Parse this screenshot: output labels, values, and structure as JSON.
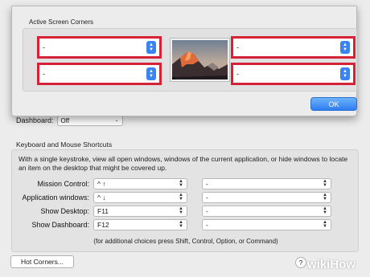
{
  "dashboard": {
    "label": "Dashboard:",
    "value": "Off"
  },
  "keyboard_section": {
    "title": "Keyboard and Mouse Shortcuts",
    "description": "With a single keystroke, view all open windows, windows of the current application, or hide windows to locate an item on the desktop that might be covered up.",
    "rows": [
      {
        "label": "Mission Control:",
        "key": "^ ↑",
        "mouse": "-"
      },
      {
        "label": "Application windows:",
        "key": "^ ↓",
        "mouse": "-"
      },
      {
        "label": "Show Desktop:",
        "key": "F11",
        "mouse": "-"
      },
      {
        "label": "Show Dashboard:",
        "key": "F12",
        "mouse": "-"
      }
    ],
    "footnote": "(for additional choices press Shift, Control, Option, or Command)"
  },
  "hot_corners_button": "Hot Corners...",
  "help_button": "?",
  "watermark": {
    "wiki": "wiki",
    "how": "How"
  },
  "sheet": {
    "title": "Active Screen Corners",
    "corners": {
      "top_left": "-",
      "bottom_left": "-",
      "top_right": "-",
      "bottom_right": "-"
    },
    "ok_label": "OK"
  },
  "colors": {
    "highlight": "#d62236",
    "accent": "#3a83f2"
  }
}
